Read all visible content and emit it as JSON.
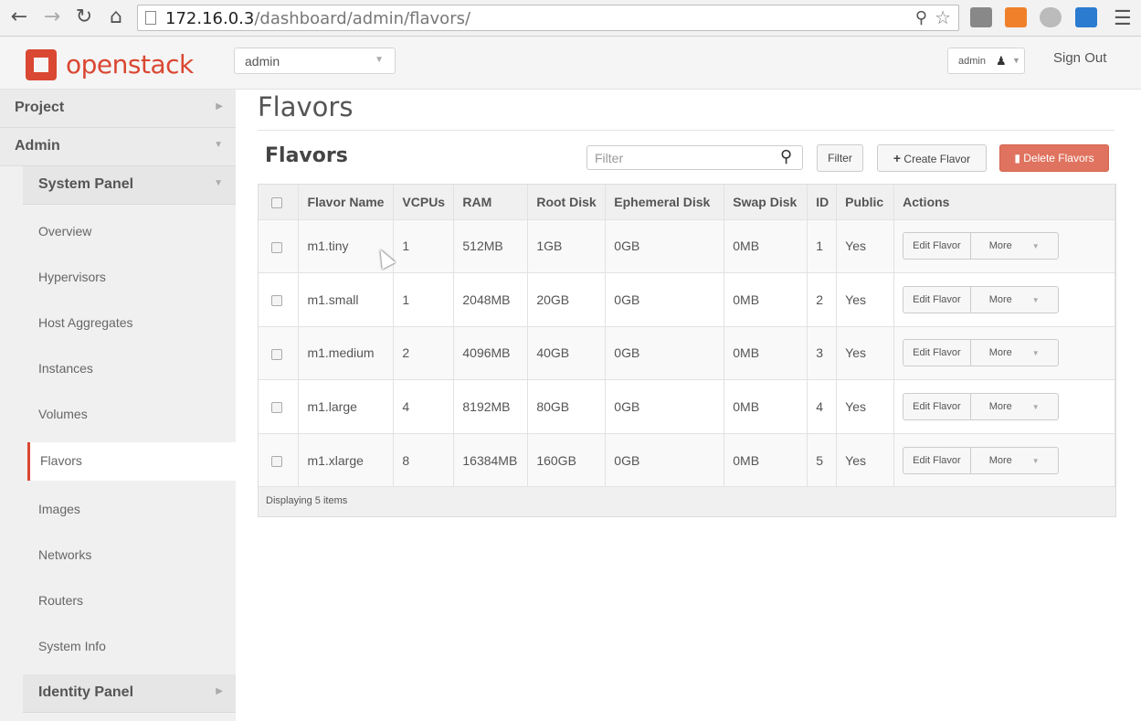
{
  "browser": {
    "url_host": "172.16.0.3",
    "url_path": "/dashboard/admin/flavors/"
  },
  "header": {
    "logo_text": "openstack",
    "project_selected": "admin",
    "user_name": "admin",
    "sign_out": "Sign Out"
  },
  "sidebar": {
    "dashboards": [
      {
        "label": "Project"
      },
      {
        "label": "Admin"
      }
    ],
    "system_panel": "System Panel",
    "items": [
      {
        "label": "Overview"
      },
      {
        "label": "Hypervisors"
      },
      {
        "label": "Host Aggregates"
      },
      {
        "label": "Instances"
      },
      {
        "label": "Volumes"
      },
      {
        "label": "Flavors"
      },
      {
        "label": "Images"
      },
      {
        "label": "Networks"
      },
      {
        "label": "Routers"
      },
      {
        "label": "System Info"
      }
    ],
    "identity_panel": "Identity Panel"
  },
  "main": {
    "page_title": "Flavors",
    "table_title": "Flavors",
    "filter_placeholder": "Filter",
    "filter_button": "Filter",
    "create_button": "Create Flavor",
    "delete_button": "Delete Flavors",
    "columns": [
      "Flavor Name",
      "VCPUs",
      "RAM",
      "Root Disk",
      "Ephemeral Disk",
      "Swap Disk",
      "ID",
      "Public",
      "Actions"
    ],
    "rows": [
      {
        "name": "m1.tiny",
        "vcpus": "1",
        "ram": "512MB",
        "root": "1GB",
        "eph": "0GB",
        "swap": "0MB",
        "id": "1",
        "public": "Yes"
      },
      {
        "name": "m1.small",
        "vcpus": "1",
        "ram": "2048MB",
        "root": "20GB",
        "eph": "0GB",
        "swap": "0MB",
        "id": "2",
        "public": "Yes"
      },
      {
        "name": "m1.medium",
        "vcpus": "2",
        "ram": "4096MB",
        "root": "40GB",
        "eph": "0GB",
        "swap": "0MB",
        "id": "3",
        "public": "Yes"
      },
      {
        "name": "m1.large",
        "vcpus": "4",
        "ram": "8192MB",
        "root": "80GB",
        "eph": "0GB",
        "swap": "0MB",
        "id": "4",
        "public": "Yes"
      },
      {
        "name": "m1.xlarge",
        "vcpus": "8",
        "ram": "16384MB",
        "root": "160GB",
        "eph": "0GB",
        "swap": "0MB",
        "id": "5",
        "public": "Yes"
      }
    ],
    "row_edit_label": "Edit Flavor",
    "row_more_label": "More",
    "footer_text": "Displaying 5 items"
  }
}
